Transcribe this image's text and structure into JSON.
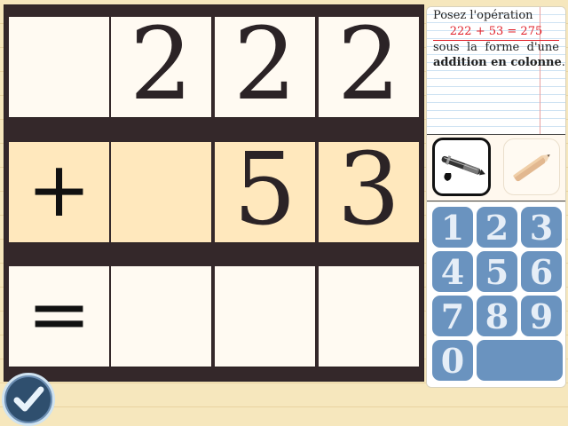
{
  "board": {
    "row1": [
      "",
      "2",
      "2",
      "2"
    ],
    "row2": [
      "+",
      "",
      "5",
      "3"
    ],
    "row3": [
      "=",
      "",
      "",
      ""
    ]
  },
  "instruction": {
    "title": "Posez l'opération",
    "equation": "222 + 53 = 275",
    "line1": "sous la forme d'une",
    "line2_bold": "addition en colonne",
    "line2_end": "."
  },
  "tools": {
    "pen_icon": "pen-icon",
    "pencil_icon": "pencil-icon"
  },
  "keypad": {
    "keys": [
      "1",
      "2",
      "3",
      "4",
      "5",
      "6",
      "7",
      "8",
      "9",
      "0"
    ],
    "blank": ""
  },
  "colors": {
    "board": "#34282a",
    "cell": "#fffaf2",
    "highlight_cell": "#ffe8bd",
    "key": "#6a93bf",
    "equation_red": "#e0202a"
  },
  "submit": {
    "icon": "checkmark-icon"
  }
}
